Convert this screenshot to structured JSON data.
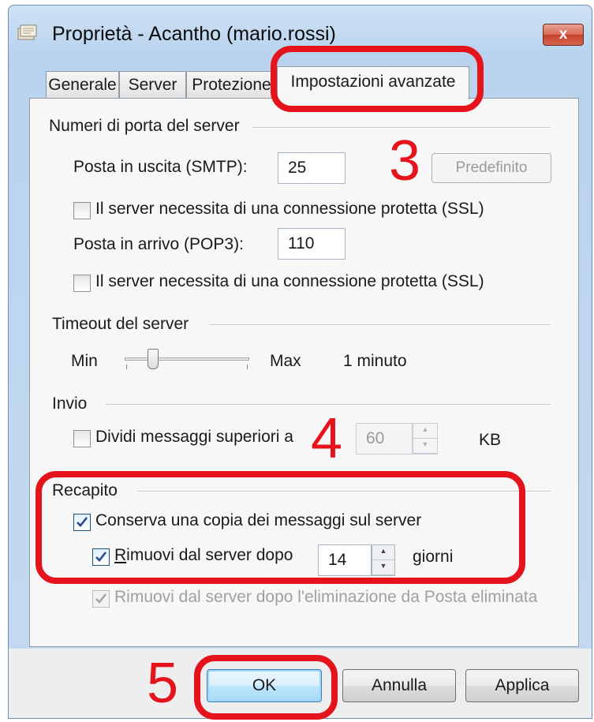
{
  "window": {
    "title": "Proprietà - Acantho (mario.rossi)",
    "close_label": "x"
  },
  "tabs": [
    {
      "label": "Generale"
    },
    {
      "label": "Server"
    },
    {
      "label": "Protezione"
    },
    {
      "label": "Impostazioni avanzate",
      "active": true
    }
  ],
  "ports": {
    "group_label": "Numeri di porta del server",
    "smtp_label": "Posta in uscita (SMTP):",
    "smtp_value": "25",
    "default_button": "Predefinito",
    "smtp_ssl_label": "Il server necessita di una connessione protetta (SSL)",
    "smtp_ssl_checked": false,
    "pop3_label": "Posta in arrivo (POP3):",
    "pop3_value": "110",
    "pop3_ssl_label": "Il server necessita di una connessione protetta (SSL)",
    "pop3_ssl_checked": false
  },
  "timeout": {
    "group_label": "Timeout del server",
    "min_label": "Min",
    "max_label": "Max",
    "value_text": "1 minuto",
    "slider_level": 0.2
  },
  "send": {
    "group_label": "Invio",
    "split_label": "Dividi messaggi superiori a",
    "split_checked": false,
    "split_value": "60",
    "unit": "KB"
  },
  "delivery": {
    "group_label": "Recapito",
    "keep_copy_label": "Conserva una copia dei messaggi sul server",
    "keep_copy_checked": true,
    "remove_after_label": "Rimuovi dal server dopo",
    "remove_after_checked": true,
    "remove_after_value": "14",
    "days_label": "giorni",
    "remove_deleted_label": "Rimuovi dal server dopo l'eliminazione da Posta eliminata",
    "remove_deleted_checked": true
  },
  "buttons": {
    "ok": "OK",
    "cancel": "Annulla",
    "apply": "Applica"
  },
  "annotations": {
    "step3": "3",
    "step4": "4",
    "step5": "5",
    "color": "#e4131c"
  }
}
